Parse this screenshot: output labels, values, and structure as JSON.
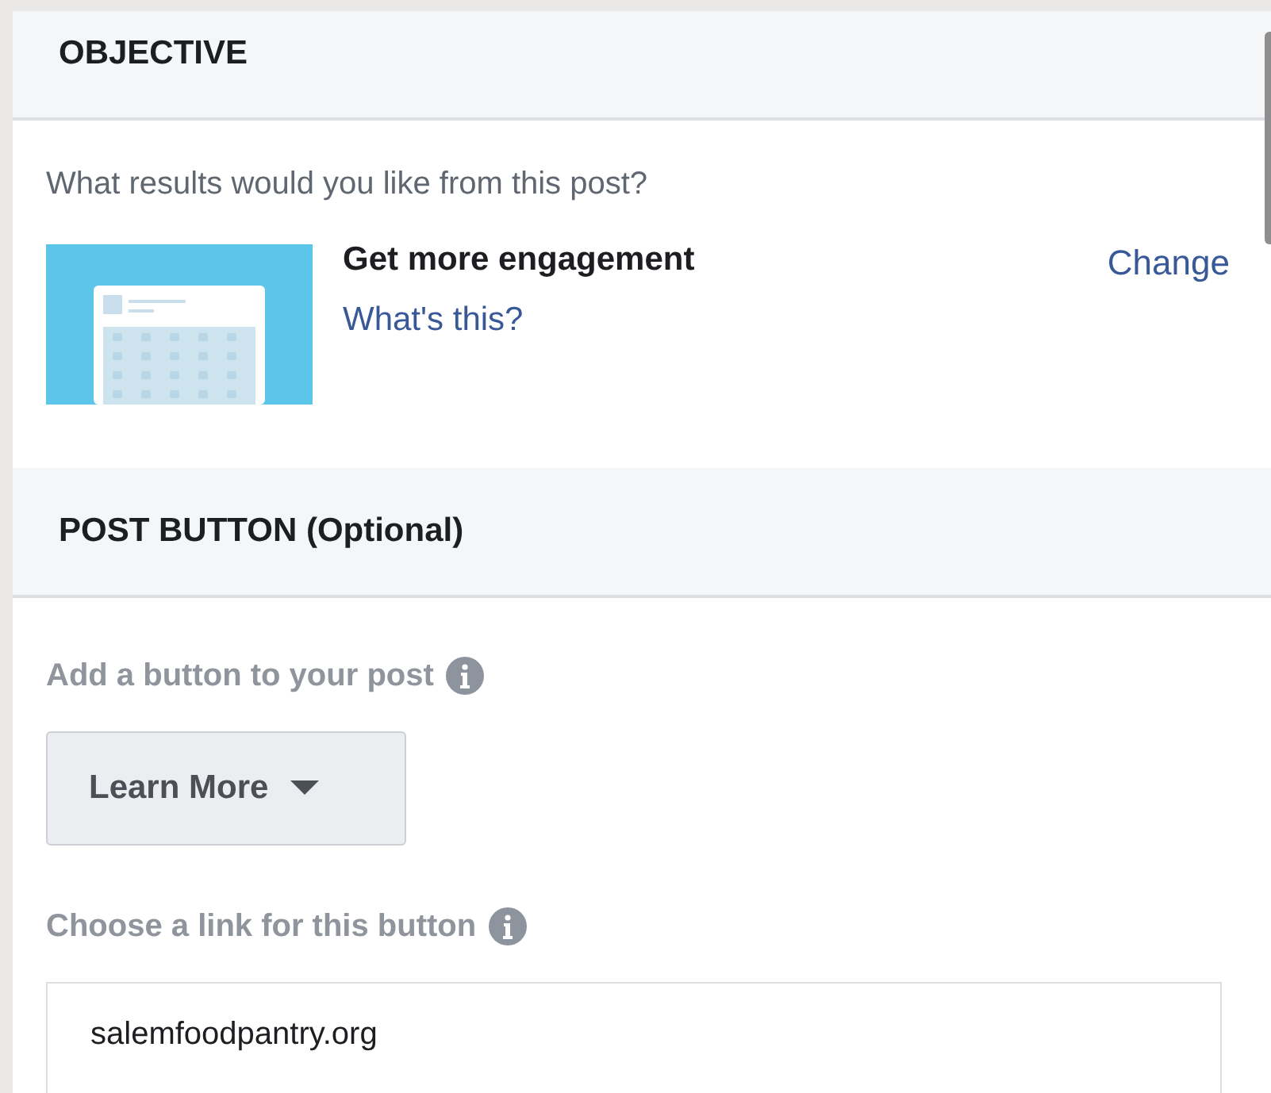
{
  "sections": [
    {
      "title": "OBJECTIVE",
      "kind": "objective",
      "prompt": "What results would you like from this post?",
      "objective": {
        "name": "Get more engagement",
        "help_link": "What's this?",
        "change_link": "Change"
      }
    },
    {
      "title": "POST BUTTON (Optional)",
      "kind": "post_button",
      "button_label": "Add a button to your post",
      "button_value": "Learn More",
      "link_label": "Choose a link for this button",
      "link_value": "salemfoodpantry.org"
    }
  ]
}
